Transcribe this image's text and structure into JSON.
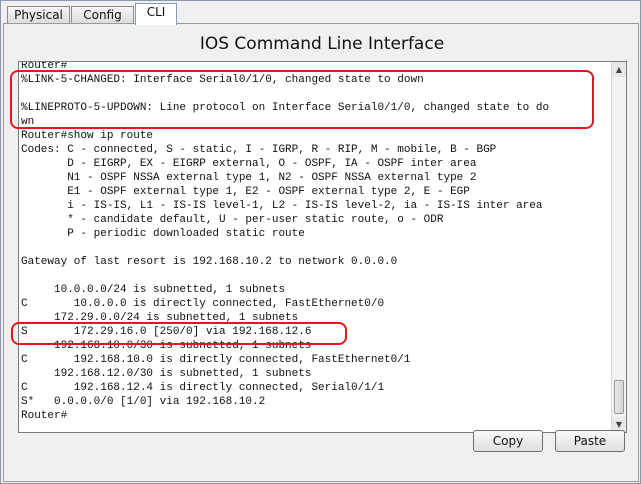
{
  "tabs": [
    {
      "label": "Physical"
    },
    {
      "label": "Config"
    },
    {
      "label": "CLI"
    }
  ],
  "active_tab": "CLI",
  "panel": {
    "title": "IOS Command Line Interface"
  },
  "console": {
    "lines": [
      "Router#",
      "%LINK-5-CHANGED: Interface Serial0/1/0, changed state to down",
      "",
      "%LINEPROTO-5-UPDOWN: Line protocol on Interface Serial0/1/0, changed state to do",
      "wn",
      "Router#show ip route",
      "Codes: C - connected, S - static, I - IGRP, R - RIP, M - mobile, B - BGP",
      "       D - EIGRP, EX - EIGRP external, O - OSPF, IA - OSPF inter area",
      "       N1 - OSPF NSSA external type 1, N2 - OSPF NSSA external type 2",
      "       E1 - OSPF external type 1, E2 - OSPF external type 2, E - EGP",
      "       i - IS-IS, L1 - IS-IS level-1, L2 - IS-IS level-2, ia - IS-IS inter area",
      "       * - candidate default, U - per-user static route, o - ODR",
      "       P - periodic downloaded static route",
      "",
      "Gateway of last resort is 192.168.10.2 to network 0.0.0.0",
      "",
      "     10.0.0.0/24 is subnetted, 1 subnets",
      "C       10.0.0.0 is directly connected, FastEthernet0/0",
      "     172.29.0.0/24 is subnetted, 1 subnets",
      "S       172.29.16.0 [250/0] via 192.168.12.6",
      "     192.168.10.0/30 is subnetted, 1 subnets",
      "C       192.168.10.0 is directly connected, FastEthernet0/1",
      "     192.168.12.0/30 is subnetted, 1 subnets",
      "C       192.168.12.4 is directly connected, Serial0/1/1",
      "S*   0.0.0.0/0 [1/0] via 192.168.10.2",
      "Router#"
    ]
  },
  "buttons": {
    "copy_label": "Copy",
    "paste_label": "Paste"
  },
  "colors": {
    "highlight": "#e1191e"
  },
  "icons": {
    "scroll_up": "up-arrow-icon",
    "scroll_down": "down-arrow-icon"
  }
}
